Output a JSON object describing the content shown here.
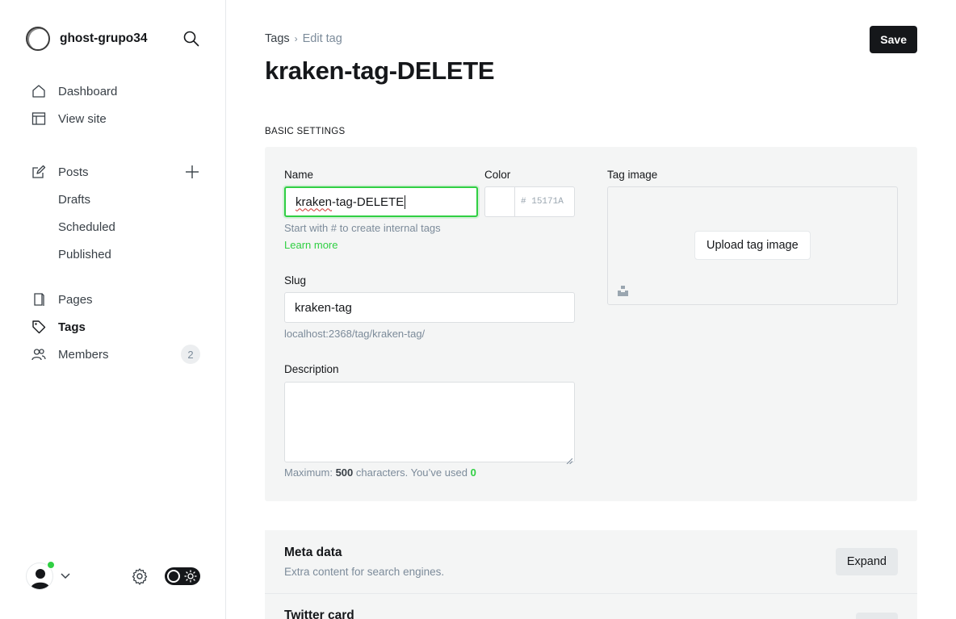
{
  "site": {
    "name": "ghost-grupo34"
  },
  "sidebar": {
    "nav": [
      {
        "label": "Dashboard",
        "icon": "home-icon"
      },
      {
        "label": "View site",
        "icon": "layout-icon"
      }
    ],
    "posts": {
      "label": "Posts",
      "icon": "pencil-icon",
      "sub": [
        "Drafts",
        "Scheduled",
        "Published"
      ]
    },
    "nav2": [
      {
        "label": "Pages",
        "icon": "pages-icon"
      },
      {
        "label": "Tags",
        "icon": "tag-icon",
        "active": true
      },
      {
        "label": "Members",
        "icon": "members-icon",
        "badge": "2"
      }
    ]
  },
  "header": {
    "breadcrumb_parent": "Tags",
    "breadcrumb_separator": "›",
    "breadcrumb_current": "Edit tag",
    "save_label": "Save",
    "title": "kraken-tag-DELETE"
  },
  "form": {
    "section_label": "BASIC SETTINGS",
    "name_label": "Name",
    "name_value_word": "kraken",
    "name_value_rest": "-tag-DELETE",
    "name_hint": "Start with # to create internal tags",
    "learn_more": "Learn more",
    "color_label": "Color",
    "color_hash": "#",
    "color_placeholder": "15171A",
    "slug_label": "Slug",
    "slug_value": "kraken-tag",
    "slug_url": "localhost:2368/tag/kraken-tag/",
    "description_label": "Description",
    "counter_prefix": "Maximum:",
    "counter_max": "500",
    "counter_mid": "characters. You’ve used",
    "counter_used": "0",
    "image_label": "Tag image",
    "upload_label": "Upload tag image"
  },
  "meta": {
    "title": "Meta data",
    "description": "Extra content for search engines.",
    "expand_label": "Expand"
  },
  "twitter": {
    "title": "Twitter card"
  },
  "colors": {
    "accent": "#30cf43",
    "dark": "#15171a",
    "panel": "#f4f5f5"
  }
}
